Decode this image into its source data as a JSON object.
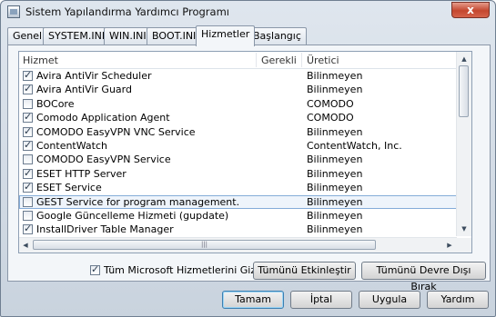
{
  "window": {
    "title": "Sistem Yapılandırma Yardımcı Programı",
    "close_label": "x"
  },
  "tabs": [
    {
      "label": "Genel"
    },
    {
      "label": "SYSTEM.INI"
    },
    {
      "label": "WIN.INI"
    },
    {
      "label": "BOOT.INI"
    },
    {
      "label": "Hizmetler",
      "active": true
    },
    {
      "label": "Başlangıç"
    }
  ],
  "services_list": {
    "columns": [
      "Hizmet",
      "Gerekli",
      "Üretici"
    ],
    "rows": [
      {
        "name": "Avira AntiVir Scheduler",
        "required": "",
        "manufacturer": "Bilinmeyen",
        "checked": true
      },
      {
        "name": "Avira AntiVir Guard",
        "required": "",
        "manufacturer": "Bilinmeyen",
        "checked": true
      },
      {
        "name": "BOCore",
        "required": "",
        "manufacturer": "COMODO",
        "checked": false
      },
      {
        "name": "Comodo Application Agent",
        "required": "",
        "manufacturer": "COMODO",
        "checked": true
      },
      {
        "name": "COMODO EasyVPN VNC Service",
        "required": "",
        "manufacturer": "Bilinmeyen",
        "checked": true
      },
      {
        "name": "ContentWatch",
        "required": "",
        "manufacturer": "ContentWatch, Inc.",
        "checked": true
      },
      {
        "name": "COMODO EasyVPN Service",
        "required": "",
        "manufacturer": "Bilinmeyen",
        "checked": false
      },
      {
        "name": "ESET HTTP Server",
        "required": "",
        "manufacturer": "Bilinmeyen",
        "checked": true
      },
      {
        "name": "ESET Service",
        "required": "",
        "manufacturer": "Bilinmeyen",
        "checked": true
      },
      {
        "name": "GEST Service for program management.",
        "required": "",
        "manufacturer": "Bilinmeyen",
        "checked": false,
        "selected": true
      },
      {
        "name": "Google Güncelleme Hizmeti (gupdate)",
        "required": "",
        "manufacturer": "Bilinmeyen",
        "checked": false
      },
      {
        "name": "InstallDriver Table Manager",
        "required": "",
        "manufacturer": "Bilinmeyen",
        "checked": true
      }
    ]
  },
  "hide_ms_services": {
    "label": "Tüm Microsoft Hizmetlerini Gizle",
    "checked": true
  },
  "buttons": {
    "enable_all": "Tümünü Etkinleştir",
    "disable_all": "Tümünü Devre Dışı Bırak",
    "ok": "Tamam",
    "cancel": "İptal",
    "apply": "Uygula",
    "help": "Yardım"
  }
}
